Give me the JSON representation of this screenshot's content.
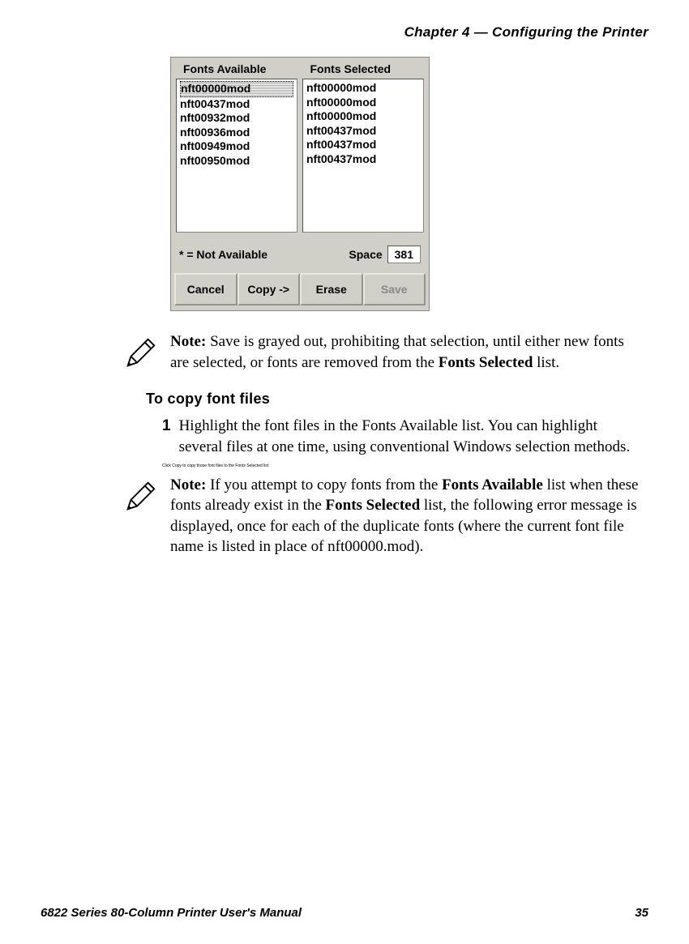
{
  "header": {
    "chapter": "Chapter 4 — Configuring the Printer"
  },
  "screenshot": {
    "headers": {
      "available": "Fonts Available",
      "selected": "Fonts Selected"
    },
    "fonts_available": [
      "nft00000mod",
      "nft00437mod",
      "nft00932mod",
      "nft00936mod",
      "nft00949mod",
      "nft00950mod"
    ],
    "fonts_selected": [
      "nft00000mod",
      "nft00000mod",
      "nft00000mod",
      "nft00437mod",
      "nft00437mod",
      "nft00437mod"
    ],
    "not_available_label": "* = Not Available",
    "space_label": "Space",
    "space_value": "381",
    "buttons": {
      "cancel": "Cancel",
      "copy": "Copy ->",
      "erase": "Erase",
      "save": "Save"
    }
  },
  "note1": {
    "prefix": "Note:",
    "text_a": " Save is grayed out, prohibiting that selection, until either new fonts are selected, or fonts are removed from the ",
    "bold_b": "Fonts Selected",
    "text_c": " list."
  },
  "section_heading": "To copy font files",
  "step1": {
    "num": "1",
    "text": "Highlight the font files in the Fonts Available list. You can highlight several files at one time, using conventional Windows selection methods."
  },
  "step2": {
    "text": "Click Copy to copy those font files to the Fonts Selected list"
  },
  "note2": {
    "prefix": "Note:",
    "text_a": " If you attempt to copy fonts from the ",
    "bold_b": "Fonts Available",
    "text_c": " list when these fonts already exist in the ",
    "bold_d": "Fonts Selected",
    "text_e": " list, the following error message is displayed, once for each of the duplicate fonts (where the current font file name is listed in place of nft00000.mod)."
  },
  "footer": {
    "manual": "6822 Series 80-Column Printer User's Manual",
    "page": "35"
  }
}
